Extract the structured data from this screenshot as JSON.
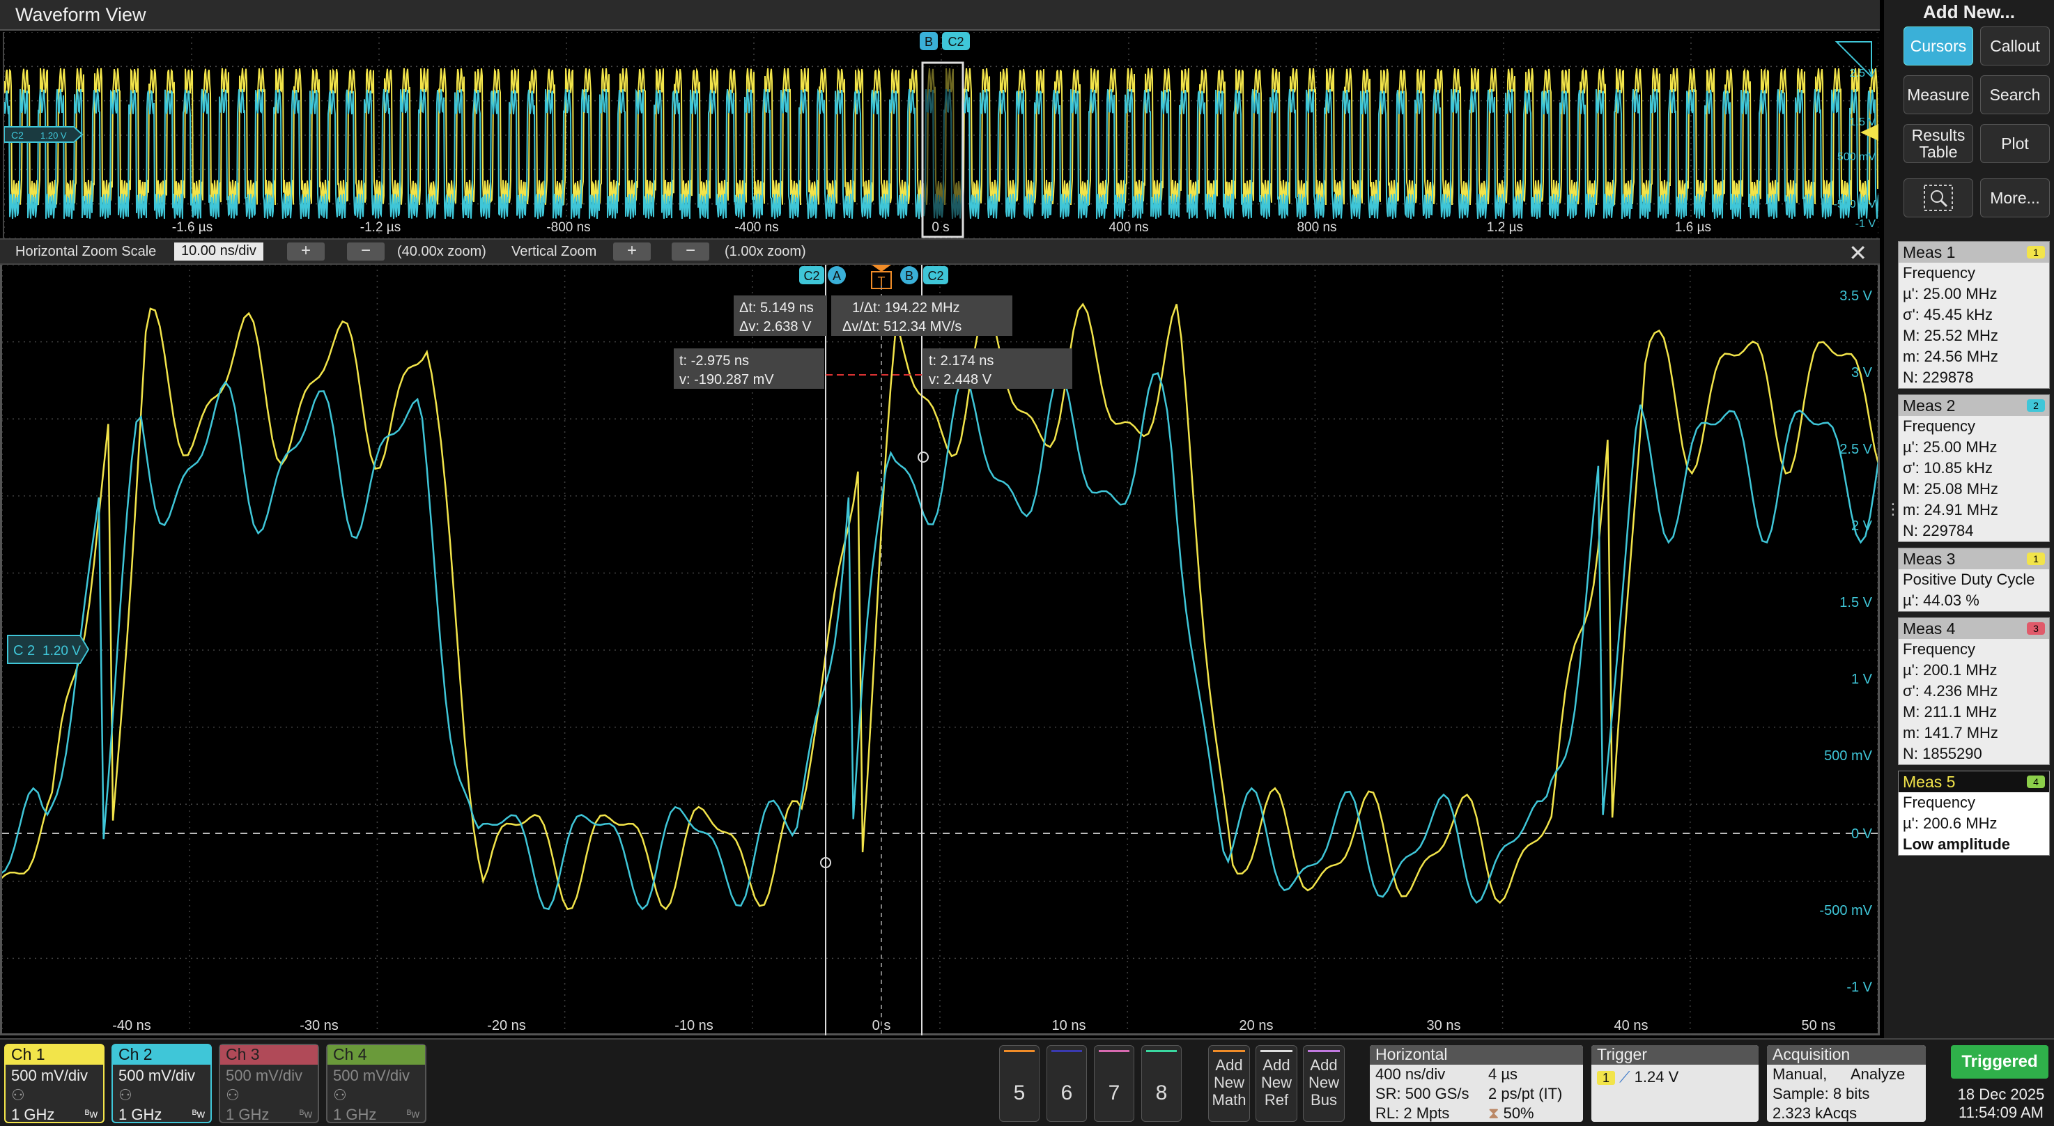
{
  "window_title": "Waveform View",
  "overview": {
    "time_labels": [
      "-1.6 µs",
      "-1.2 µs",
      "-800 ns",
      "-400 ns",
      "0 s",
      "400 ns",
      "800 ns",
      "1.2 µs",
      "1.6 µs"
    ],
    "volt_labels": [
      "2.5 V",
      "1.5 V",
      "500 mV",
      "-500 mV",
      "-1 V"
    ],
    "ch2_offset": "1.20 V",
    "cursor_b": "B",
    "cursor_c2": "C2"
  },
  "zoom_bar": {
    "h_label": "Horizontal Zoom Scale",
    "h_value": "10.00 ns/div",
    "h_plus": "+",
    "h_minus": "−",
    "h_zoom": "(40.00x zoom)",
    "v_label": "Vertical Zoom",
    "v_plus": "+",
    "v_minus": "−",
    "v_zoom": "(1.00x zoom)",
    "close": "✕"
  },
  "main": {
    "time_labels": [
      "-40 ns",
      "-30 ns",
      "-20 ns",
      "-10 ns",
      "0 s",
      "10 ns",
      "20 ns",
      "30 ns",
      "40 ns",
      "50 ns"
    ],
    "volt_labels": [
      "3.5 V",
      "3 V",
      "2.5 V",
      "2 V",
      "1.5 V",
      "1 V",
      "500 mV",
      "0 V",
      "-500 mV",
      "-1 V"
    ],
    "ch2_label": "C 2",
    "ch2_offset": "1.20 V",
    "cursor_tags": {
      "c2a": "C2",
      "a": "A",
      "t": "T",
      "b": "B",
      "c2b": "C2"
    },
    "readout_delta": {
      "dt": "Δt: 5.149 ns",
      "dv": "Δv: 2.638 V",
      "inv_dt": "1/Δt: 194.22 MHz",
      "dvdt": "Δv/Δt: 512.34 MV/s"
    },
    "readout_a": {
      "t": "t: -2.975 ns",
      "v": "v: -190.287 mV"
    },
    "readout_b": {
      "t": "t: 2.174 ns",
      "v": "v: 2.448 V"
    }
  },
  "side": {
    "title": "Add New...",
    "buttons": {
      "cursors": "Cursors",
      "callout": "Callout",
      "measure": "Measure",
      "search": "Search",
      "results": "Results Table",
      "plot": "Plot",
      "more": "More..."
    },
    "meas": [
      {
        "title": "Meas 1",
        "badge": "1",
        "badge_color": "#f2e44a",
        "rows": [
          "Frequency",
          "µ': 25.00 MHz",
          "σ': 45.45 kHz",
          "M: 25.52 MHz",
          "m: 24.56 MHz",
          "N: 229878"
        ]
      },
      {
        "title": "Meas 2",
        "badge": "2",
        "badge_color": "#3fc6d8",
        "rows": [
          "Frequency",
          "µ': 25.00 MHz",
          "σ': 10.85 kHz",
          "M: 25.08 MHz",
          "m: 24.91 MHz",
          "N: 229784"
        ]
      },
      {
        "title": "Meas 3",
        "badge": "1",
        "badge_color": "#f2e44a",
        "rows": [
          "Positive Duty Cycle",
          "µ': 44.03 %"
        ]
      },
      {
        "title": "Meas 4",
        "badge": "3",
        "badge_color": "#e05a6a",
        "rows": [
          "Frequency",
          "µ': 200.1 MHz",
          "σ': 4.236 MHz",
          "M: 211.1 MHz",
          "m: 141.7 MHz",
          "N: 1855290"
        ]
      },
      {
        "title": "Meas 5",
        "badge": "4",
        "badge_color": "#8ccf4a",
        "rows": [
          "Frequency",
          "µ': 200.6 MHz",
          "Low amplitude"
        ]
      }
    ]
  },
  "bottom": {
    "channels": [
      {
        "name": "Ch 1",
        "scale": "500 mV/div",
        "bw": "1 GHz",
        "color": "#f2e44a"
      },
      {
        "name": "Ch 2",
        "scale": "500 mV/div",
        "bw": "1 GHz",
        "color": "#3fc6d8"
      },
      {
        "name": "Ch 3",
        "scale": "500 mV/div",
        "bw": "1 GHz",
        "color": "#b04a58"
      },
      {
        "name": "Ch 4",
        "scale": "500 mV/div",
        "bw": "1 GHz",
        "color": "#6a9a3a"
      }
    ],
    "nums": [
      "5",
      "6",
      "7",
      "8"
    ],
    "add_math": "Add New Math",
    "add_ref": "Add New Ref",
    "add_bus": "Add New Bus",
    "horizontal": {
      "title": "Horizontal",
      "scale": "400 ns/div",
      "dur": "4 µs",
      "sr": "SR: 500 GS/s",
      "pts": "2 ps/pt (IT)",
      "rl": "RL: 2 Mpts",
      "pos": "50%"
    },
    "trigger": {
      "title": "Trigger",
      "src": "1",
      "level": "1.24 V"
    },
    "acquisition": {
      "title": "Acquisition",
      "mode": "Manual,",
      "analyze": "Analyze",
      "sample": "Sample: 8 bits",
      "acqs": "2.323 kAcqs"
    },
    "status": "Triggered",
    "date": "18 Dec 2025",
    "time": "11:54:09 AM"
  }
}
